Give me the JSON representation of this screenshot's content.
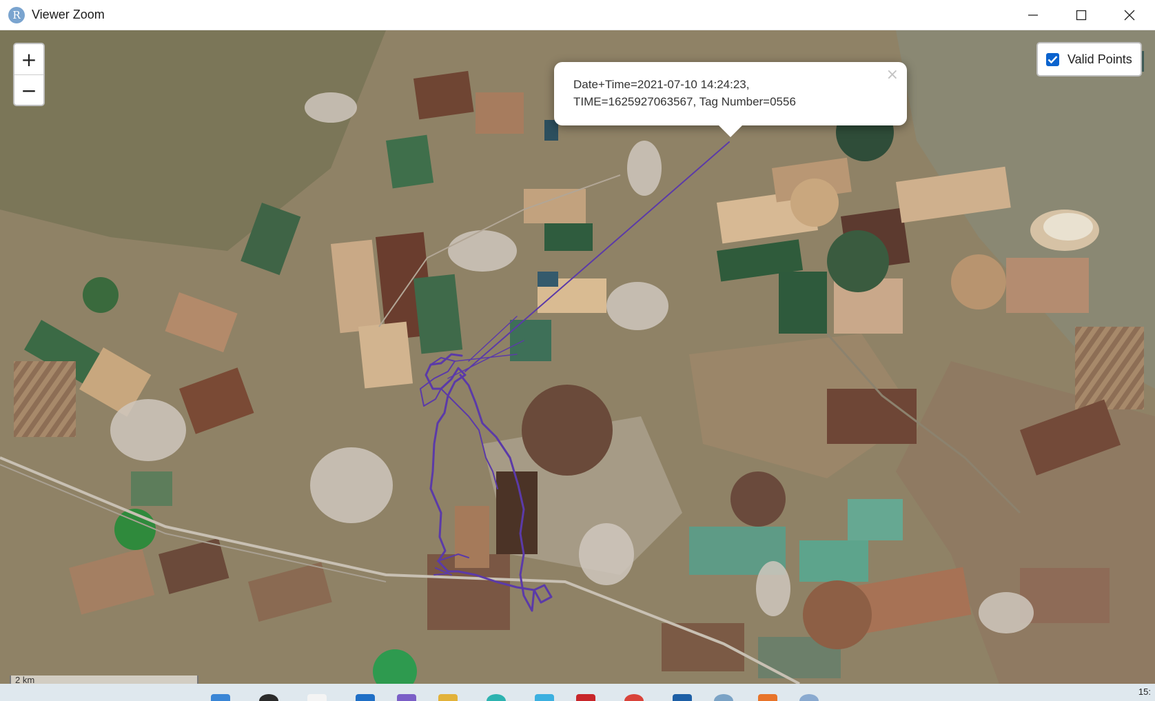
{
  "window": {
    "title": "Viewer Zoom",
    "app_icon_letter": "R",
    "controls": [
      "minimize-icon",
      "maximize-icon",
      "close-icon"
    ]
  },
  "map": {
    "zoom_in_label": "+",
    "zoom_out_label": "−",
    "layer_control": {
      "label": "Valid Points",
      "checked": true
    },
    "popup": {
      "text": "Date+Time=2021-07-10 14:24:23,\nTIME=1625927063567, Tag Number=0556",
      "close_label": "×"
    },
    "scale_label": "2 km",
    "track_color": "#5b3aa8"
  },
  "taskbar": {
    "clock_partial": "15:"
  }
}
